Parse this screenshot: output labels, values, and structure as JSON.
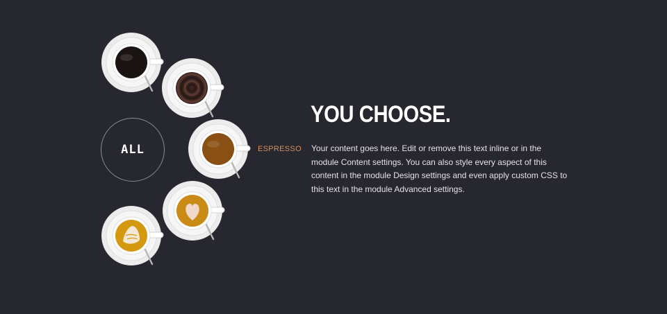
{
  "filter": {
    "all_label": "ALL",
    "active_label": "ESPRESSO",
    "label_color": "#d9905a"
  },
  "cups": [
    {
      "name": "black-coffee-cup",
      "fill_color": "#1a1412",
      "topping": "none"
    },
    {
      "name": "chocolate-swirl-cup",
      "fill_color": "#3a2520",
      "topping": "swirl"
    },
    {
      "name": "espresso-cup",
      "fill_color": "#8a4f12",
      "topping": "none"
    },
    {
      "name": "latte-heart-cup",
      "fill_color": "#c98a16",
      "topping": "heart"
    },
    {
      "name": "latte-art-cup",
      "fill_color": "#d4990f",
      "topping": "leaf"
    }
  ],
  "content": {
    "heading": "YOU CHOOSE.",
    "body": "Your content goes here. Edit or remove this text inline or in the module Content settings. You can also style every aspect of this content in the module Design settings and even apply custom CSS to this text in the module Advanced settings."
  },
  "colors": {
    "background": "#272730",
    "heading": "#ffffff",
    "body": "#e2e2e6"
  }
}
